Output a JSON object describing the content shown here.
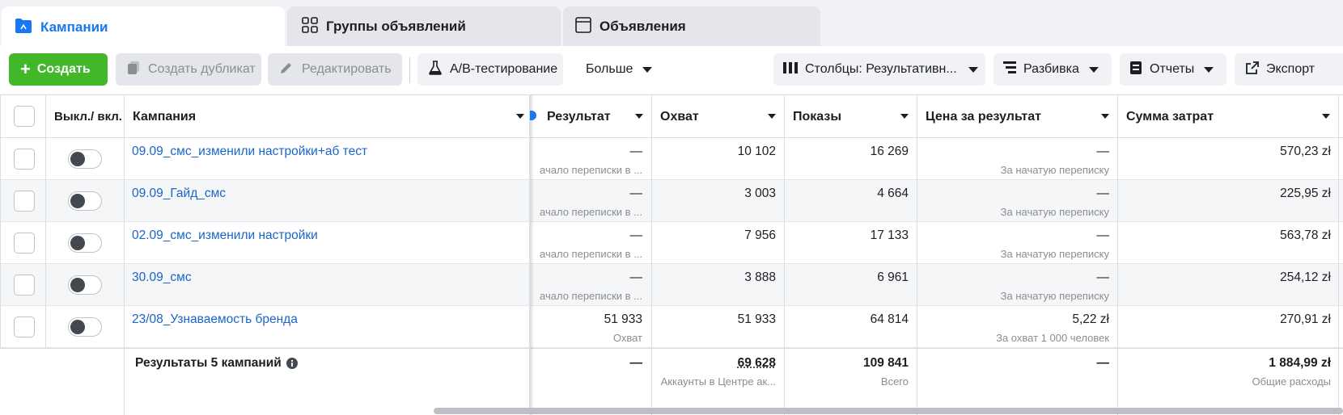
{
  "tabs": [
    {
      "label": "Кампании",
      "active": true,
      "icon": "folder-icon"
    },
    {
      "label": "Группы объявлений",
      "active": false,
      "icon": "grid-icon"
    },
    {
      "label": "Объявления",
      "active": false,
      "icon": "ad-icon"
    }
  ],
  "toolbar": {
    "create": "Создать",
    "duplicate": "Создать дубликат",
    "edit": "Редактировать",
    "ab_test": "A/B-тестирование",
    "more": "Больше",
    "columns": "Столбцы: Результативн...",
    "breakdown": "Разбивка",
    "reports": "Отчеты",
    "export": "Экспорт"
  },
  "columns": {
    "toggle": "Выкл./ вкл.",
    "campaign": "Кампания",
    "result": "Результат",
    "reach": "Охват",
    "impressions": "Показы",
    "cost_per_result": "Цена за результат",
    "spend": "Сумма затрат"
  },
  "rows": [
    {
      "name": "09.09_смс_изменили настройки+аб тест",
      "result": "—",
      "result_sub": "ачало переписки в ...",
      "reach": "10 102",
      "impressions": "16 269",
      "cpr": "—",
      "cpr_sub": "За начатую переписку",
      "spend": "570,23 zł"
    },
    {
      "name": "09.09_Гайд_смс",
      "result": "—",
      "result_sub": "ачало переписки в ...",
      "reach": "3 003",
      "impressions": "4 664",
      "cpr": "—",
      "cpr_sub": "За начатую переписку",
      "spend": "225,95 zł"
    },
    {
      "name": "02.09_смс_изменили настройки",
      "result": "—",
      "result_sub": "ачало переписки в ...",
      "reach": "7 956",
      "impressions": "17 133",
      "cpr": "—",
      "cpr_sub": "За начатую переписку",
      "spend": "563,78 zł"
    },
    {
      "name": "30.09_смс",
      "result": "—",
      "result_sub": "ачало переписки в ...",
      "reach": "3 888",
      "impressions": "6 961",
      "cpr": "—",
      "cpr_sub": "За начатую переписку",
      "spend": "254,12 zł"
    },
    {
      "name": "23/08_Узнаваемость бренда",
      "result": "51 933",
      "result_sub": "Охват",
      "reach": "51 933",
      "impressions": "64 814",
      "cpr": "5,22 zł",
      "cpr_sub": "За охват 1 000 человек",
      "spend": "270,91 zł"
    }
  ],
  "totals": {
    "label": "Результаты 5 кампаний",
    "result": "—",
    "reach": "69 628",
    "reach_sub": "Аккаунты в Центре ак...",
    "impressions": "109 841",
    "impressions_sub": "Всего",
    "cpr": "—",
    "spend": "1 884,99 zł",
    "spend_sub": "Общие расходы"
  },
  "colors": {
    "accent": "#1877f2",
    "create": "#42b72a",
    "link": "#1a65c9"
  }
}
